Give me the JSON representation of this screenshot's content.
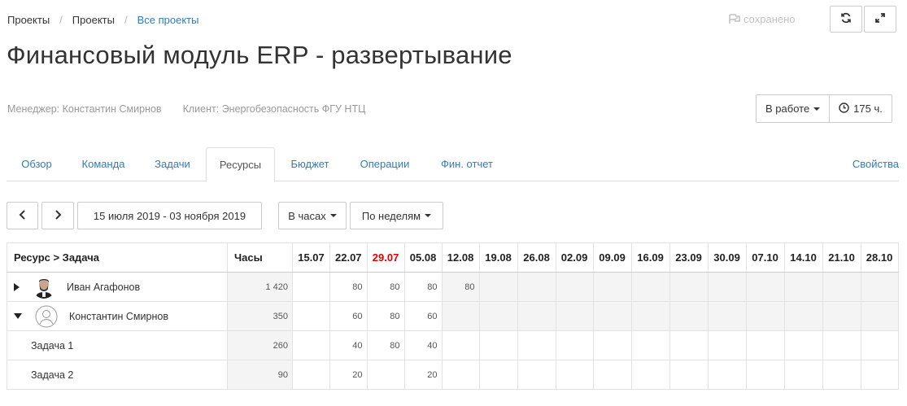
{
  "breadcrumb": {
    "item1": "Проекты",
    "sep": "/",
    "item2": "Проекты",
    "item3": "Все проекты"
  },
  "saved_label": "сохранено",
  "title": "Финансовый модуль ERP - развертывание",
  "meta": {
    "manager_label": "Менеджер:",
    "manager": "Константин Смирнов",
    "client_label": "Клиент:",
    "client": "Энергобезопасность ФГУ НТЦ"
  },
  "status": {
    "label": "В работе",
    "hours": "175 ч."
  },
  "tabs": [
    "Обзор",
    "Команда",
    "Задачи",
    "Ресурсы",
    "Бюджет",
    "Операции",
    "Фин. отчет"
  ],
  "tab_props": "Свойства",
  "toolbar": {
    "date_range": "15 июля 2019 - 03 ноября 2019",
    "unit": "В часах",
    "period": "По неделям"
  },
  "table": {
    "col_resource": "Ресурс > Задача",
    "col_hours": "Часы",
    "weeks": [
      "15.07",
      "22.07",
      "29.07",
      "05.08",
      "12.08",
      "19.08",
      "26.08",
      "02.09",
      "09.09",
      "16.09",
      "23.09",
      "30.09",
      "07.10",
      "14.10",
      "21.10",
      "28.10"
    ],
    "highlight_week": "29.07",
    "highlight_color": "#e00000",
    "rows": [
      {
        "kind": "person",
        "expanded": false,
        "name": "Иван Агафонов",
        "hours": "1 420",
        "cells": [
          "",
          "80",
          "80",
          "80",
          "80",
          "",
          "",
          "",
          "",
          "",
          "",
          "",
          "",
          "",
          "",
          ""
        ]
      },
      {
        "kind": "person",
        "expanded": true,
        "name": "Константин Смирнов",
        "hours": "350",
        "cells": [
          "",
          "60",
          "80",
          "60",
          "",
          "",
          "",
          "",
          "",
          "",
          "",
          "",
          "",
          "",
          "",
          ""
        ]
      },
      {
        "kind": "task",
        "name": "Задача 1",
        "hours": "260",
        "cells": [
          "",
          "40",
          "80",
          "40",
          "",
          "",
          "",
          "",
          "",
          "",
          "",
          "",
          "",
          "",
          "",
          ""
        ]
      },
      {
        "kind": "task",
        "name": "Задача 2",
        "hours": "90",
        "cells": [
          "",
          "20",
          "",
          "20",
          "",
          "",
          "",
          "",
          "",
          "",
          "",
          "",
          "",
          "",
          "",
          ""
        ]
      }
    ]
  },
  "colors": {
    "link": "#337ab7",
    "muted": "#999999",
    "cell_shade": "#f4f4f4"
  }
}
